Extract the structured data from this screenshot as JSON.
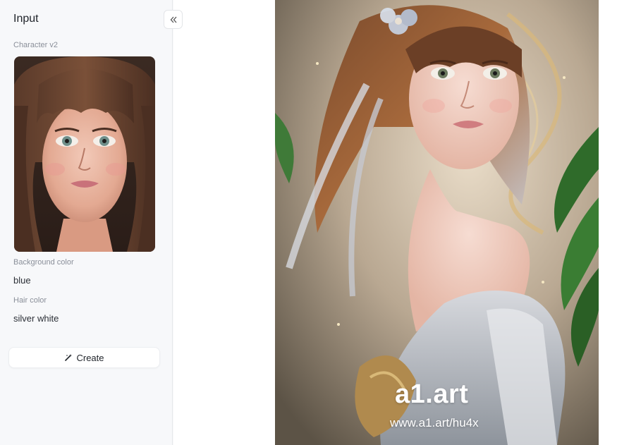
{
  "panel": {
    "title": "Input",
    "character_label": "Character v2",
    "background_label": "Background color",
    "background_value": "blue",
    "hair_label": "Hair color",
    "hair_value": "silver white",
    "create_label": "Create"
  },
  "result": {
    "watermark_brand": "a1.art",
    "watermark_url": "www.a1.art/hu4x"
  }
}
